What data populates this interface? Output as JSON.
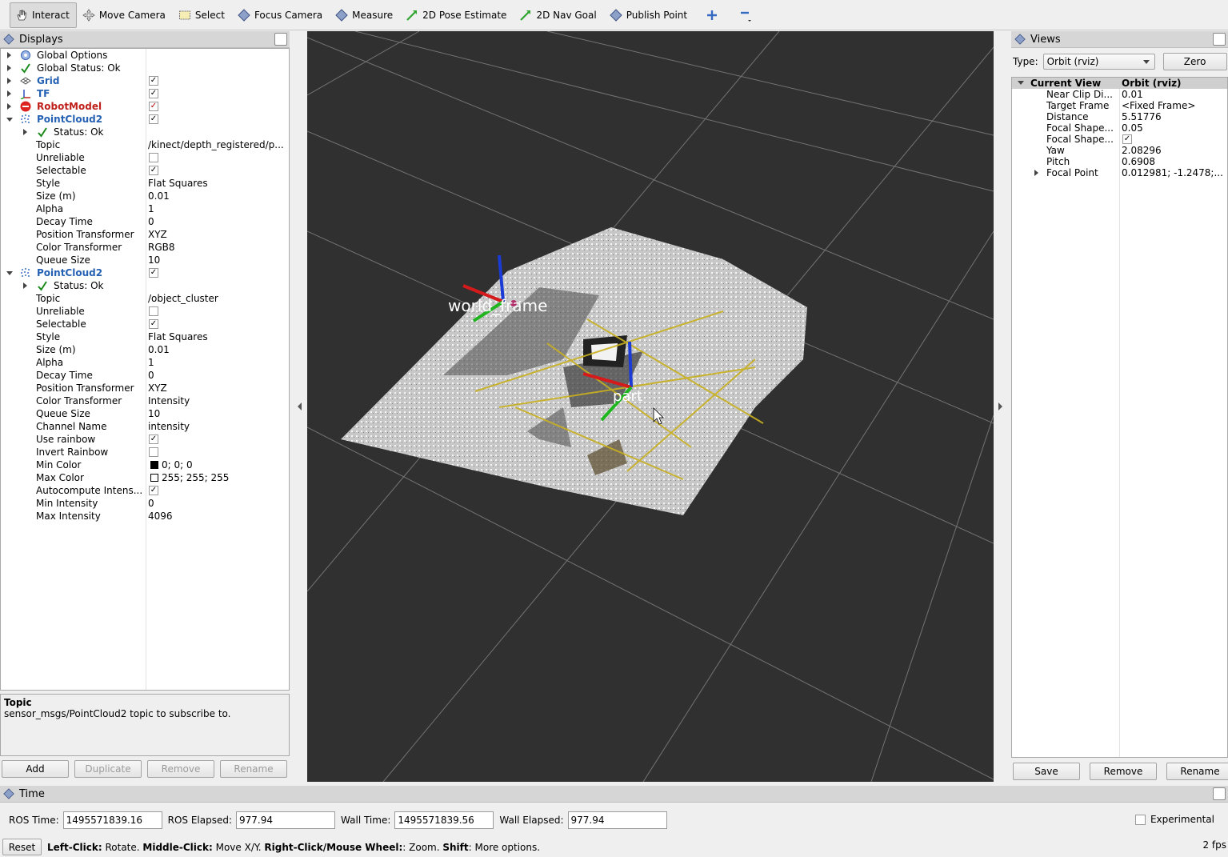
{
  "toolbar": {
    "tools": [
      {
        "label": "Interact",
        "icon": "hand-icon"
      },
      {
        "label": "Move Camera",
        "icon": "move-camera-icon"
      },
      {
        "label": "Select",
        "icon": "select-box-icon"
      },
      {
        "label": "Focus Camera",
        "icon": "diamond-icon"
      },
      {
        "label": "Measure",
        "icon": "diamond-icon"
      },
      {
        "label": "2D Pose Estimate",
        "icon": "green-arrow-icon"
      },
      {
        "label": "2D Nav Goal",
        "icon": "green-arrow-icon"
      },
      {
        "label": "Publish Point",
        "icon": "diamond-icon"
      }
    ]
  },
  "displays": {
    "title": "Displays",
    "items": {
      "global_options": "Global Options",
      "global_status": "Global Status: Ok",
      "grid": "Grid",
      "tf": "TF",
      "robot_model": "RobotModel",
      "pc1": "PointCloud2",
      "pc1_status": "Status: Ok",
      "pc2": "PointCloud2",
      "pc2_status": "Status: Ok"
    },
    "pc1_props": [
      {
        "name": "Topic",
        "value": "/kinect/depth_registered/p..."
      },
      {
        "name": "Unreliable",
        "value": ""
      },
      {
        "name": "Selectable",
        "value": ""
      },
      {
        "name": "Style",
        "value": "Flat Squares"
      },
      {
        "name": "Size (m)",
        "value": "0.01"
      },
      {
        "name": "Alpha",
        "value": "1"
      },
      {
        "name": "Decay Time",
        "value": "0"
      },
      {
        "name": "Position Transformer",
        "value": "XYZ"
      },
      {
        "name": "Color Transformer",
        "value": "RGB8"
      },
      {
        "name": "Queue Size",
        "value": "10"
      }
    ],
    "pc2_props": [
      {
        "name": "Topic",
        "value": "/object_cluster"
      },
      {
        "name": "Unreliable",
        "value": ""
      },
      {
        "name": "Selectable",
        "value": ""
      },
      {
        "name": "Style",
        "value": "Flat Squares"
      },
      {
        "name": "Size (m)",
        "value": "0.01"
      },
      {
        "name": "Alpha",
        "value": "1"
      },
      {
        "name": "Decay Time",
        "value": "0"
      },
      {
        "name": "Position Transformer",
        "value": "XYZ"
      },
      {
        "name": "Color Transformer",
        "value": "Intensity"
      },
      {
        "name": "Queue Size",
        "value": "10"
      },
      {
        "name": "Channel Name",
        "value": "intensity"
      },
      {
        "name": "Use rainbow",
        "value": ""
      },
      {
        "name": "Invert Rainbow",
        "value": ""
      },
      {
        "name": "Min Color",
        "value": "0; 0; 0"
      },
      {
        "name": "Max Color",
        "value": "255; 255; 255"
      },
      {
        "name": "Autocompute Intens...",
        "value": ""
      },
      {
        "name": "Min Intensity",
        "value": "0"
      },
      {
        "name": "Max Intensity",
        "value": "4096"
      }
    ],
    "description_title": "Topic",
    "description_text": "sensor_msgs/PointCloud2 topic to subscribe to.",
    "buttons": {
      "add": "Add",
      "duplicate": "Duplicate",
      "remove": "Remove",
      "rename": "Rename"
    }
  },
  "viewport": {
    "frame_labels": {
      "world": "world_frame",
      "part": "part"
    }
  },
  "views": {
    "title": "Views",
    "type_label": "Type:",
    "type_value": "Orbit (rviz)",
    "zero": "Zero",
    "current_view": "Current View",
    "current_view_type": "Orbit (rviz)",
    "props": [
      {
        "name": "Near Clip Di...",
        "value": "0.01"
      },
      {
        "name": "Target Frame",
        "value": "<Fixed Frame>"
      },
      {
        "name": "Distance",
        "value": "5.51776"
      },
      {
        "name": "Focal Shape...",
        "value": "0.05"
      },
      {
        "name": "Focal Shape...",
        "value": ""
      },
      {
        "name": "Yaw",
        "value": "2.08296"
      },
      {
        "name": "Pitch",
        "value": "0.6908"
      },
      {
        "name": "Focal Point",
        "value": "0.012981; -1.2478;..."
      }
    ],
    "buttons": {
      "save": "Save",
      "remove": "Remove",
      "rename": "Rename"
    }
  },
  "time": {
    "title": "Time",
    "ros_time_label": "ROS Time:",
    "ros_time": "1495571839.16",
    "ros_elapsed_label": "ROS Elapsed:",
    "ros_elapsed": "977.94",
    "wall_time_label": "Wall Time:",
    "wall_time": "1495571839.56",
    "wall_elapsed_label": "Wall Elapsed:",
    "wall_elapsed": "977.94",
    "experimental": "Experimental"
  },
  "status": {
    "reset": "Reset",
    "k1": "Left-Click:",
    "t1": " Rotate. ",
    "k2": "Middle-Click:",
    "t2": " Move X/Y. ",
    "k3": "Right-Click/Mouse Wheel:",
    "t3": ": Zoom. ",
    "k4": "Shift",
    "t4": ": More options.",
    "fps": "2 fps"
  },
  "colors": {
    "viewport_bg": "#303030",
    "link_blue": "#2561b3",
    "error_red": "#c0201a"
  }
}
